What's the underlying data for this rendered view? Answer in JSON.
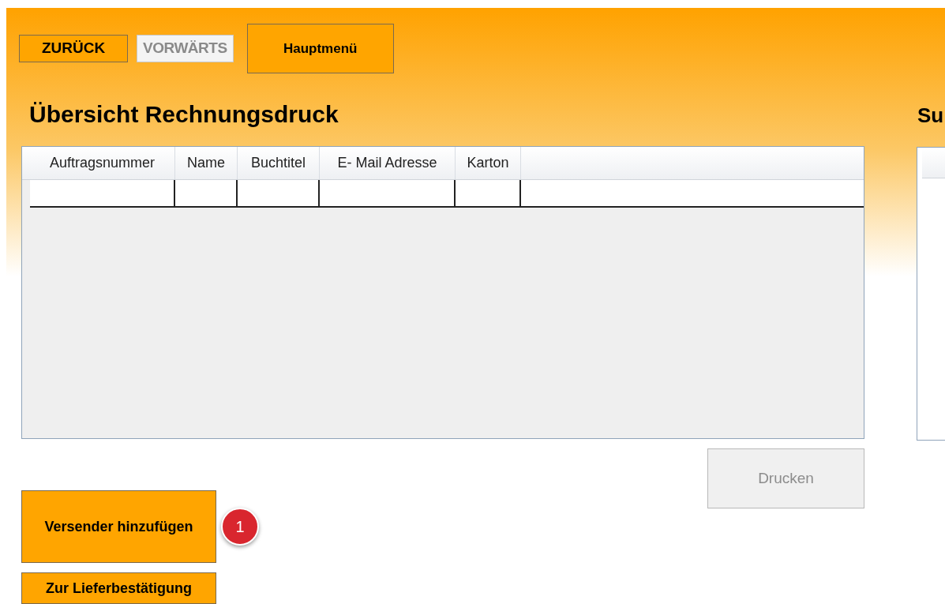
{
  "nav_buttons": [
    {
      "label": "ZURÜCK",
      "disabled": false
    },
    {
      "label": "VORWÄRTS",
      "disabled": true
    }
  ],
  "main_menu_button": {
    "label": "Hauptmenü"
  },
  "title": "Übersicht Rechnungsdruck",
  "table": {
    "columns": [
      "Auftragsnummer",
      "Name",
      "Buchtitel",
      "E- Mail Adresse",
      "Karton"
    ]
  },
  "print_button": {
    "label": "Drucken",
    "disabled": true
  },
  "side_buttons": [
    {
      "label": "Versender hinzufügen",
      "badge": "1"
    },
    {
      "label": "Zur Lieferbestätigung"
    }
  ],
  "right_panel": {
    "title": "Su"
  }
}
